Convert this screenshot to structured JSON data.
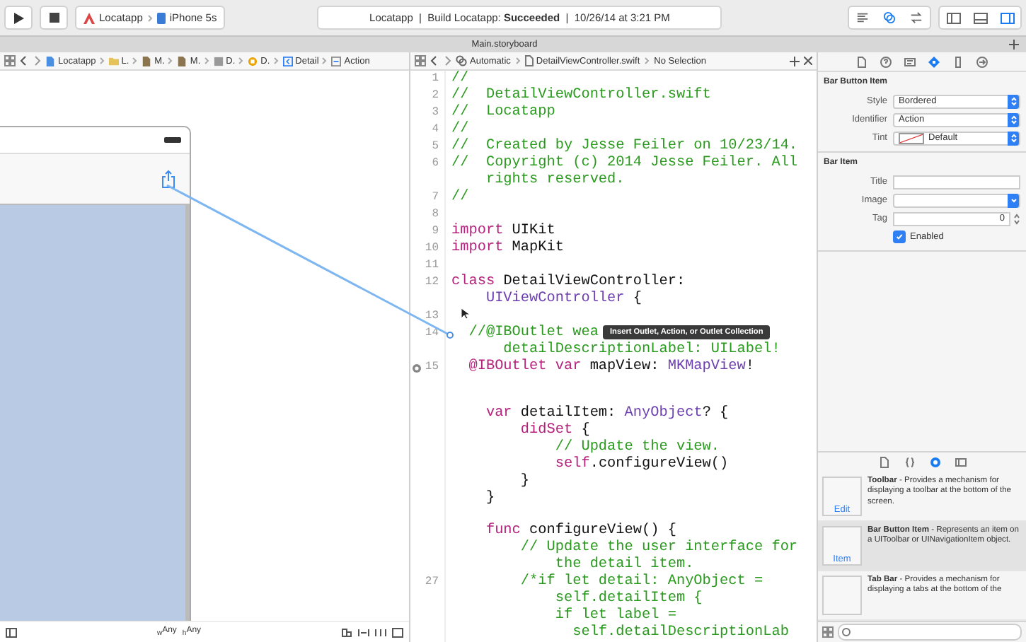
{
  "toolbar": {
    "scheme": {
      "project": "Locatapp",
      "device": "iPhone 5s"
    },
    "activity": "Locatapp  |  Build Locatapp: **Succeeded**  |  10/26/14 at 3:21 PM",
    "editor_modes": [
      {
        "kind": "standard",
        "selected": false
      },
      {
        "kind": "assistant",
        "selected": true
      },
      {
        "kind": "version",
        "selected": false
      }
    ],
    "panels": [
      {
        "kind": "navigator",
        "selected": false
      },
      {
        "kind": "debug",
        "selected": false
      },
      {
        "kind": "utilities",
        "selected": true
      }
    ]
  },
  "tab": {
    "title": "Main.storyboard"
  },
  "storyboard_jump_bar": [
    {
      "label": "Locatapp",
      "kind": "file"
    },
    {
      "label": "L.",
      "kind": "folder"
    },
    {
      "label": "M.",
      "kind": "storyboard"
    },
    {
      "label": "M.",
      "kind": "storyboard"
    },
    {
      "label": "D.",
      "kind": "scene"
    },
    {
      "label": "D.",
      "kind": "controller"
    },
    {
      "label": "Detail",
      "kind": "navitem"
    },
    {
      "label": "Action",
      "kind": "barbutton"
    }
  ],
  "code_jump_bar": {
    "mode": "Automatic",
    "file": "DetailViewController.swift",
    "selection": "No Selection"
  },
  "code_rows": [
    {
      "number": "1",
      "segments": [
        {
          "text": "//",
          "kind": "comment"
        }
      ]
    },
    {
      "number": "2",
      "segments": [
        {
          "text": "//  DetailViewController.swift",
          "kind": "comment"
        }
      ]
    },
    {
      "number": "3",
      "segments": [
        {
          "text": "//  Locatapp",
          "kind": "comment"
        }
      ]
    },
    {
      "number": "4",
      "segments": [
        {
          "text": "//",
          "kind": "comment"
        }
      ]
    },
    {
      "number": "5",
      "segments": [
        {
          "text": "//  Created by Jesse Feiler on 10/23/14.",
          "kind": "comment"
        }
      ]
    },
    {
      "number": "6",
      "segments": [
        {
          "text": "//  Copyright (c) 2014 Jesse Feiler. All",
          "kind": "comment"
        }
      ]
    },
    {
      "segments": [
        {
          "text": "    rights reserved.",
          "kind": "comment"
        }
      ]
    },
    {
      "number": "7",
      "segments": [
        {
          "text": "//",
          "kind": "comment"
        }
      ]
    },
    {
      "number": "8"
    },
    {
      "number": "9",
      "segments": [
        {
          "text": "import",
          "kind": "keyword"
        },
        {
          "text": " UIKit",
          "kind": "plain"
        }
      ]
    },
    {
      "number": "10",
      "segments": [
        {
          "text": "import",
          "kind": "keyword"
        },
        {
          "text": " MapKit",
          "kind": "plain"
        }
      ]
    },
    {
      "number": "11"
    },
    {
      "number": "12",
      "segments": [
        {
          "text": "class",
          "kind": "keyword"
        },
        {
          "text": " DetailViewController:",
          "kind": "plain"
        }
      ]
    },
    {
      "segments": [
        {
          "text": "    UIViewController",
          "kind": "type"
        },
        {
          "text": " {",
          "kind": "plain"
        }
      ]
    },
    {
      "number": "13"
    },
    {
      "number": "14",
      "segments": [
        {
          "text": "  //@IBOutlet wea",
          "kind": "comment"
        }
      ]
    },
    {
      "segments": [
        {
          "text": "      detailDescriptionLabel: UILabel!",
          "kind": "comment"
        }
      ]
    },
    {
      "number": "15",
      "connected": true,
      "segments": [
        {
          "text": "  @IBOutlet var",
          "kind": "keyword"
        },
        {
          "text": " mapView: ",
          "kind": "plain"
        },
        {
          "text": "MKMapView",
          "kind": "type"
        },
        {
          "text": "!",
          "kind": "plain"
        }
      ]
    },
    {},
    {},
    {
      "segments": [
        {
          "text": "    var",
          "kind": "keyword"
        },
        {
          "text": " detailItem: ",
          "kind": "plain"
        },
        {
          "text": "AnyObject",
          "kind": "type"
        },
        {
          "text": "? {",
          "kind": "plain"
        }
      ]
    },
    {
      "segments": [
        {
          "text": "        didSet",
          "kind": "keyword"
        },
        {
          "text": " {",
          "kind": "plain"
        }
      ]
    },
    {
      "segments": [
        {
          "text": "            // Update the view.",
          "kind": "comment"
        }
      ]
    },
    {
      "segments": [
        {
          "text": "            self",
          "kind": "keyword"
        },
        {
          "text": ".configureView()",
          "kind": "plain"
        }
      ]
    },
    {
      "segments": [
        {
          "text": "        }",
          "kind": "plain"
        }
      ]
    },
    {
      "segments": [
        {
          "text": "    }",
          "kind": "plain"
        }
      ]
    },
    {},
    {
      "segments": [
        {
          "text": "    func",
          "kind": "keyword"
        },
        {
          "text": " configureView() {",
          "kind": "plain"
        }
      ]
    },
    {
      "segments": [
        {
          "text": "        // Update the user interface for",
          "kind": "comment"
        }
      ]
    },
    {
      "segments": [
        {
          "text": "            the detail item.",
          "kind": "comment"
        }
      ]
    },
    {
      "number": "27",
      "segments": [
        {
          "text": "        /*if let detail: AnyObject =",
          "kind": "comment"
        }
      ]
    },
    {
      "segments": [
        {
          "text": "            self.detailItem {",
          "kind": "comment"
        }
      ]
    },
    {
      "segments": [
        {
          "text": "            if let label =",
          "kind": "comment"
        }
      ]
    },
    {
      "segments": [
        {
          "text": "              self.detailDescriptionLab",
          "kind": "comment"
        }
      ]
    }
  ],
  "tooltip": "Insert Outlet, Action, or Outlet Collection",
  "canvas_bottom": {
    "size_classes": [
      "$_{w}$Any",
      "$_{h}$Any"
    ]
  },
  "inspector": {
    "tabs": [
      {
        "kind": "file",
        "selected": false
      },
      {
        "kind": "help",
        "selected": false
      },
      {
        "kind": "identity",
        "selected": false
      },
      {
        "kind": "attributes",
        "selected": true
      },
      {
        "kind": "size",
        "selected": false
      },
      {
        "kind": "connections",
        "selected": false
      }
    ],
    "sections": [
      {
        "title": "Bar Button Item",
        "fields": [
          {
            "label": "Style",
            "kind": "popup",
            "value": "Bordered"
          },
          {
            "label": "Identifier",
            "kind": "popup",
            "value": "Action"
          },
          {
            "label": "Tint",
            "kind": "color_popup",
            "value": "Default"
          }
        ]
      },
      {
        "title": "Bar Item",
        "fields": [
          {
            "label": "Title",
            "kind": "text"
          },
          {
            "label": "Image",
            "kind": "combo"
          },
          {
            "label": "Tag",
            "kind": "stepper",
            "value": "0"
          },
          {
            "label": "Enabled",
            "kind": "checkbox",
            "checked": true
          }
        ]
      }
    ]
  },
  "library": {
    "tabs": [
      {
        "kind": "file",
        "selected": false
      },
      {
        "kind": "code",
        "selected": false
      },
      {
        "kind": "object",
        "selected": true
      },
      {
        "kind": "media",
        "selected": false
      }
    ],
    "items": [
      {
        "title": "Toolbar",
        "description": " - Provides a mechanism for displaying a toolbar at the bottom of the screen.",
        "thumb": "Edit",
        "selected": false
      },
      {
        "title": "Bar Button Item",
        "description": " - Represents an item on a UIToolbar or UINavigationItem object.",
        "thumb": "Item",
        "selected": true
      },
      {
        "title": "Tab Bar",
        "description": " - Provides a mechanism for displaying a tabs at the bottom of the",
        "selected": false
      }
    ]
  }
}
